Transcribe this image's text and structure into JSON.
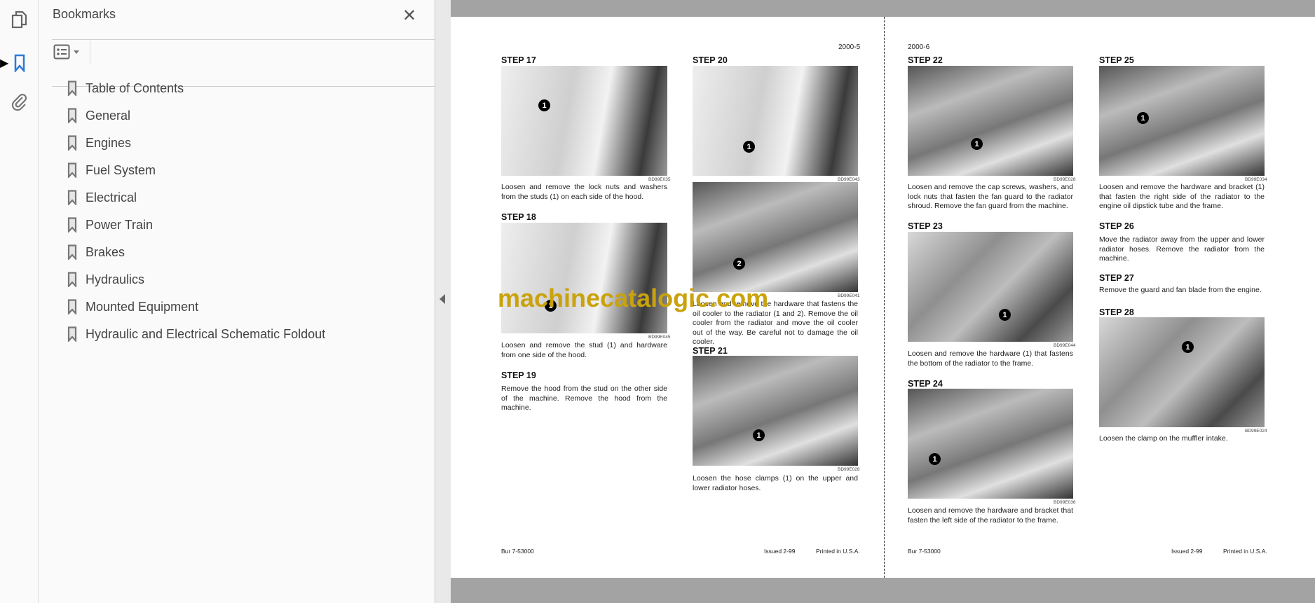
{
  "sidebar": {
    "title": "Bookmarks",
    "rail": [
      "pages-icon",
      "bookmark-icon",
      "attachment-icon"
    ],
    "bookmarks": [
      "Table of Contents",
      "General",
      "Engines",
      "Fuel System",
      "Electrical",
      "Power Train",
      "Brakes",
      "Hydraulics",
      "Mounted Equipment",
      "Hydraulic and Electrical Schematic Foldout"
    ],
    "accent": "#2d7ad6"
  },
  "left_page": {
    "page_number": "2000-5",
    "steps": [
      {
        "heading": "STEP  17",
        "code": "BD99E035",
        "callout": "1",
        "text": "Loosen and remove the lock nuts and washers from the studs (1) on each side of the hood."
      },
      {
        "heading": "STEP  18",
        "code": "BD99E045",
        "callout": "1",
        "text": "Loosen and remove the stud (1) and hardware from one side of the hood."
      },
      {
        "heading": "STEP  19",
        "text": "Remove the hood from the stud on the other side of the machine. Remove the hood from the machine."
      },
      {
        "heading": "STEP  20",
        "code": "BD99E043",
        "code2": "BD99E041",
        "callout": "1",
        "callout2": "2",
        "text": "Loosen and remove the hardware that fastens the oil cooler to the radiator (1 and 2). Remove the oil cooler from the radiator and move the oil cooler out of the way. Be careful not to damage the oil cooler."
      },
      {
        "heading": "STEP  21",
        "code": "BD99E028",
        "callout": "1",
        "text": "Loosen the hose clamps (1) on the upper and lower radiator hoses."
      }
    ],
    "footer": {
      "doc": "Bur 7-53000",
      "issued": "Issued 2-99",
      "printed": "Printed in U.S.A."
    }
  },
  "right_page": {
    "page_number": "2000-6",
    "steps": [
      {
        "heading": "STEP  22",
        "code": "BD99E028",
        "callout": "1",
        "text": "Loosen and remove the cap screws, washers, and lock nuts that fasten the fan guard to the radiator shroud. Remove the fan guard from the machine."
      },
      {
        "heading": "STEP  23",
        "code": "BD99E044",
        "callout": "1",
        "text": "Loosen and remove the hardware (1) that fastens the bottom of the radiator to the frame."
      },
      {
        "heading": "STEP  24",
        "code": "BD99E036",
        "callout": "1",
        "text": "Loosen and remove the hardware and bracket that fasten the left side of the radiator to the frame."
      },
      {
        "heading": "STEP  25",
        "code": "BD99E034",
        "callout": "1",
        "text": "Loosen and remove the hardware and bracket (1) that fasten the right side of the radiator to the engine oil dipstick tube and the frame."
      },
      {
        "heading": "STEP  26",
        "text": "Move the radiator away from the upper and lower radiator hoses. Remove the radiator from the machine."
      },
      {
        "heading": "STEP  27",
        "text": "Remove the guard and fan blade from the engine."
      },
      {
        "heading": "STEP  28",
        "code": "BD99E024",
        "callout": "1",
        "text": "Loosen the clamp on the muffler intake."
      }
    ],
    "footer": {
      "doc": "Bur 7-53000",
      "issued": "Issued 2-99",
      "printed": "Printed in U.S.A."
    }
  },
  "watermark": "machinecatalogic.com"
}
